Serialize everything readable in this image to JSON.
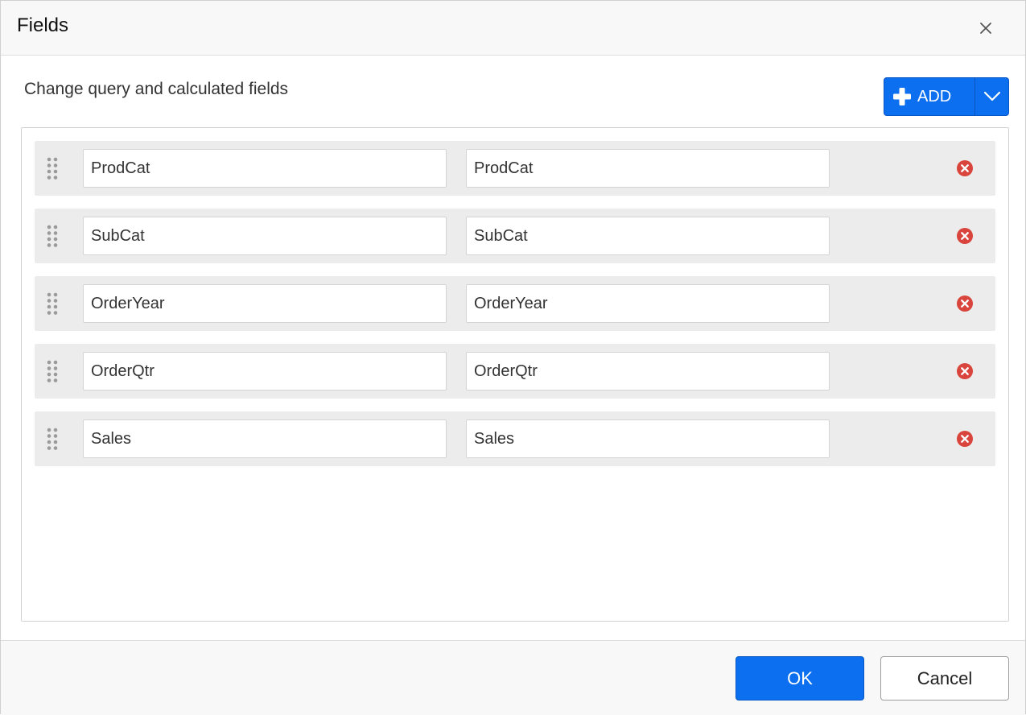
{
  "dialog": {
    "title": "Fields",
    "close_icon": "close-icon"
  },
  "main": {
    "subtitle": "Change query and calculated fields",
    "add_button": {
      "label": "ADD",
      "icon": "plus-icon",
      "dropdown_icon": "chevron-down-icon"
    },
    "fields": [
      {
        "name": "ProdCat",
        "value": "ProdCat"
      },
      {
        "name": "SubCat",
        "value": "SubCat"
      },
      {
        "name": "OrderYear",
        "value": "OrderYear"
      },
      {
        "name": "OrderQtr",
        "value": "OrderQtr"
      },
      {
        "name": "Sales",
        "value": "Sales"
      }
    ]
  },
  "footer": {
    "ok_label": "OK",
    "cancel_label": "Cancel"
  },
  "colors": {
    "accent": "#0b6ff0",
    "remove": "#d9443c",
    "row_bg": "#ececec"
  }
}
